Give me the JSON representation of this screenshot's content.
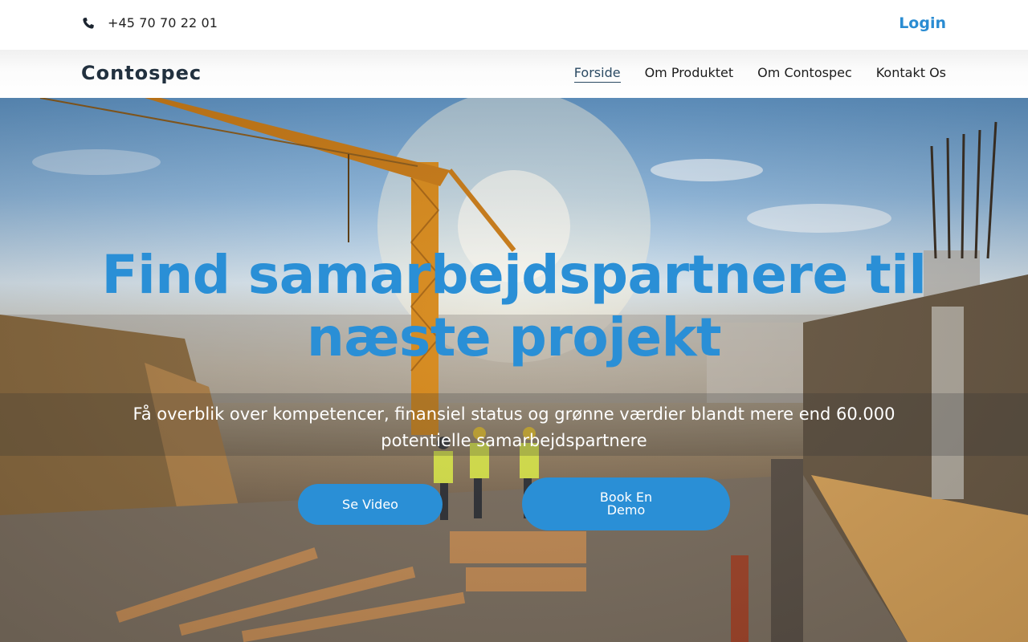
{
  "topbar": {
    "phone_icon": "phone-icon",
    "phone": "+45 70 70 22 01",
    "login": "Login"
  },
  "navbar": {
    "logo": "Contospec",
    "items": [
      {
        "label": "Forside",
        "active": true
      },
      {
        "label": "Om Produktet",
        "active": false
      },
      {
        "label": "Om Contospec",
        "active": false
      },
      {
        "label": "Kontakt Os",
        "active": false
      }
    ]
  },
  "hero": {
    "title": "Find samarbejdspartnere til næste projekt",
    "subtitle": "Få overblik over kompetencer, finansiel status og grønne værdier blandt mere end 60.000 potentielle samarbejdspartnere",
    "video_button": "Se Video",
    "demo_button": "Book En Demo"
  },
  "colors": {
    "accent": "#2a8fd6",
    "logo": "#22313f",
    "active_nav": "#2b4a63"
  }
}
